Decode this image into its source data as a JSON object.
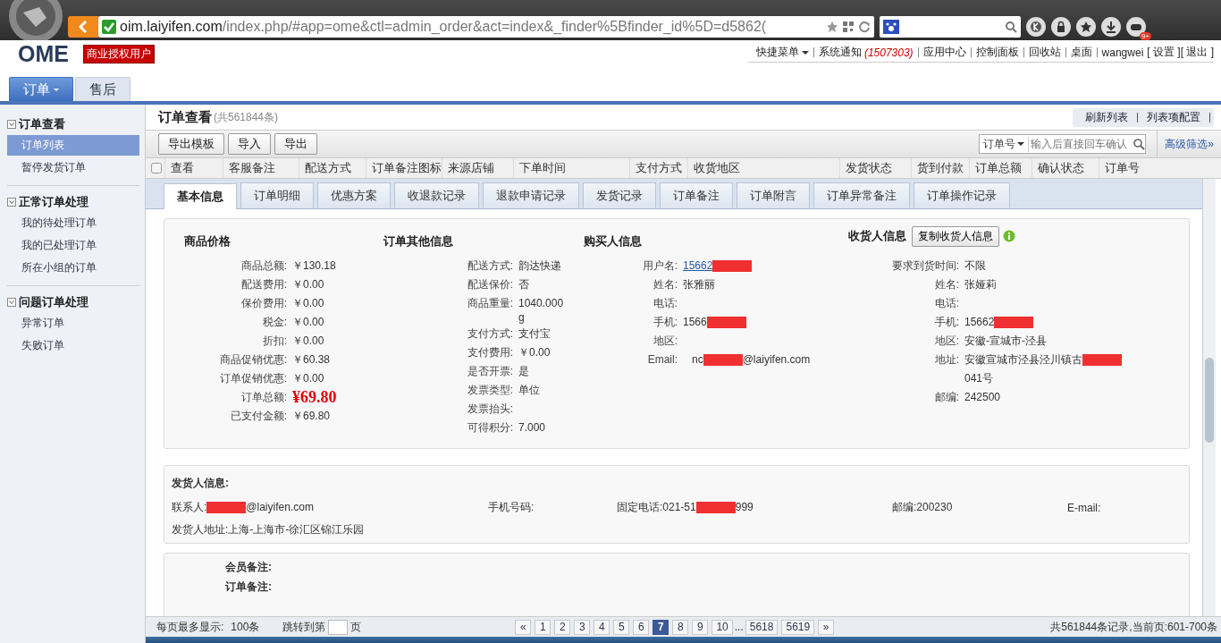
{
  "browser": {
    "url_host": "oim.laiyifen.com",
    "url_path": "/index.php/#app=ome&ctl=admin_order&act=index&_finder%5Bfinder_id%5D=d5862(",
    "badge": "9+"
  },
  "header": {
    "logo": "OME",
    "license_badge": "商业授权用户",
    "links": [
      {
        "kind": "menu",
        "label": "快捷菜单"
      },
      {
        "kind": "link",
        "label": "系统通知"
      },
      {
        "kind": "count",
        "label": "(1507303)"
      },
      {
        "kind": "link",
        "label": "应用中心"
      },
      {
        "kind": "link",
        "label": "控制面板"
      },
      {
        "kind": "link",
        "label": "回收站"
      },
      {
        "kind": "link",
        "label": "桌面"
      },
      {
        "kind": "user",
        "label": "wangwei"
      },
      {
        "kind": "bracket",
        "label": "[ 设置 ]"
      },
      {
        "kind": "bracket",
        "label": "[ 退出 ]"
      }
    ],
    "tabs": [
      {
        "label": "订单",
        "selected": true,
        "dropdown": true
      },
      {
        "label": "售后",
        "selected": false,
        "dropdown": false
      }
    ]
  },
  "sidebar": {
    "groups": [
      {
        "title": "订单查看",
        "expanded": true,
        "items": [
          {
            "label": "订单列表",
            "selected": true
          },
          {
            "label": "暂停发货订单",
            "selected": false
          }
        ]
      },
      {
        "title": "正常订单处理",
        "expanded": true,
        "items": [
          {
            "label": "我的待处理订单",
            "selected": false
          },
          {
            "label": "我的已处理订单",
            "selected": false
          },
          {
            "label": "所在小组的订单",
            "selected": false
          }
        ]
      },
      {
        "title": "问题订单处理",
        "expanded": true,
        "items": [
          {
            "label": "异常订单",
            "selected": false
          },
          {
            "label": "失败订单",
            "selected": false
          }
        ]
      }
    ]
  },
  "main": {
    "title": "订单查看",
    "count": "(共561844条)",
    "actions": [
      "刷新列表",
      "列表项配置"
    ],
    "toolbar": [
      "导出模板",
      "导入",
      "导出"
    ],
    "search": {
      "field": "订单号",
      "placeholder": "输入后直接回车确认"
    },
    "advanced": "高级筛选»",
    "header_checkbox": {
      "checked": false
    },
    "columns": [
      "查看",
      "客服备注",
      "配送方式",
      "订单备注图标",
      "来源店铺",
      "下单时间",
      "支付方式",
      "收货地区",
      "发货状态",
      "货到付款",
      "订单总额",
      "确认状态",
      "订单号"
    ],
    "detail_tabs": [
      {
        "label": "基本信息",
        "selected": true
      },
      {
        "label": "订单明细",
        "selected": false
      },
      {
        "label": "优惠方案",
        "selected": false
      },
      {
        "label": "收退款记录",
        "selected": false
      },
      {
        "label": "退款申请记录",
        "selected": false
      },
      {
        "label": "发货记录",
        "selected": false
      },
      {
        "label": "订单备注",
        "selected": false
      },
      {
        "label": "订单附言",
        "selected": false
      },
      {
        "label": "订单异常备注",
        "selected": false
      },
      {
        "label": "订单操作记录",
        "selected": false
      }
    ],
    "sections": [
      {
        "title": "商品价格",
        "fields": [
          {
            "label": "商品总额:",
            "value": "￥130.18"
          },
          {
            "label": "配送费用:",
            "value": "￥0.00"
          },
          {
            "label": "保价费用:",
            "value": "￥0.00"
          },
          {
            "label": "税金:",
            "value": "￥0.00"
          },
          {
            "label": "折扣:",
            "value": "￥0.00"
          },
          {
            "label": "商品促销优惠:",
            "value": "￥60.38"
          },
          {
            "label": "订单促销优惠:",
            "value": "￥0.00"
          },
          {
            "label": "订单总额:",
            "value": "¥69.80",
            "kind": "total"
          },
          {
            "label": "已支付金额:",
            "value": "￥69.80"
          }
        ]
      },
      {
        "title": "订单其他信息",
        "fields": [
          {
            "label": "配送方式:",
            "value": "韵达快递"
          },
          {
            "label": "配送保价:",
            "value": "否"
          },
          {
            "label": "商品重量:",
            "value": "1040.000 g",
            "kind": "narrow"
          },
          {
            "label": "支付方式:",
            "value": "支付宝"
          },
          {
            "label": "支付费用:",
            "value": "￥0.00"
          },
          {
            "label": "是否开票:",
            "value": "是"
          },
          {
            "label": "发票类型:",
            "value": "单位"
          },
          {
            "label": "发票抬头:"
          },
          {
            "label": "可得积分:",
            "value": "7.000"
          }
        ]
      },
      {
        "title": "购买人信息",
        "fields": [
          {
            "label": "用户名:",
            "value": "15662",
            "kind": "link",
            "redacted": true
          },
          {
            "label": "姓名:",
            "value": "张雅丽"
          },
          {
            "label": "电话:"
          },
          {
            "label": "手机:",
            "value": "1566",
            "redacted": true
          },
          {
            "label": "地区:"
          },
          {
            "label": "Email:",
            "value": "nc",
            "redacted": true,
            "after": "@laiyifen.com"
          }
        ]
      },
      {
        "title": "收货人信息",
        "button": "复制收货人信息",
        "fields": [
          {
            "label": "要求到货时间:",
            "value": "不限"
          },
          {
            "label": "姓名:",
            "value": "张娅莉"
          },
          {
            "label": "电话:"
          },
          {
            "label": "手机:",
            "value": "15662",
            "redacted": true
          },
          {
            "label": "地区:",
            "value": "安徽-宣城市-泾县"
          },
          {
            "label": "地址:",
            "value": "安徽宣城市泾县泾川镇古",
            "redacted": true,
            "after": "041号"
          },
          {
            "label": "邮编:",
            "value": "242500"
          }
        ]
      }
    ],
    "sender": {
      "title": "发货人信息:",
      "fields": [
        {
          "label": "联系人:",
          "redacted": true,
          "after": "@laiyifen.com"
        },
        {
          "label": "手机号码:"
        },
        {
          "label": "固定电话:",
          "value": "021-51",
          "redacted": true,
          "after": "999"
        },
        {
          "label": "邮编:",
          "value": "200230"
        },
        {
          "label": "E-mail:"
        }
      ],
      "address_label": "发货人地址:",
      "address": "上海-上海市-徐汇区锦江乐园"
    },
    "notes": [
      "会员备注:",
      "订单备注:"
    ]
  },
  "pager": {
    "per_page_label": "每页最多显示:",
    "per_page": "100条",
    "jump_label": "跳转到第",
    "jump_suffix": "页",
    "pages": [
      {
        "label": "«",
        "selected": false
      },
      {
        "label": "1",
        "selected": false
      },
      {
        "label": "2",
        "selected": false
      },
      {
        "label": "3",
        "selected": false
      },
      {
        "label": "4",
        "selected": false
      },
      {
        "label": "5",
        "selected": false
      },
      {
        "label": "6",
        "selected": false
      },
      {
        "label": "7",
        "selected": true
      },
      {
        "label": "8",
        "selected": false
      },
      {
        "label": "9",
        "selected": false
      },
      {
        "label": "10",
        "selected": false
      },
      {
        "label": "...",
        "kind": "ellipsis"
      },
      {
        "label": "5618",
        "selected": false
      },
      {
        "label": "5619",
        "selected": false
      },
      {
        "label": "»",
        "selected": false
      }
    ],
    "summary": "共561844条记录,当前页:601-700条"
  }
}
